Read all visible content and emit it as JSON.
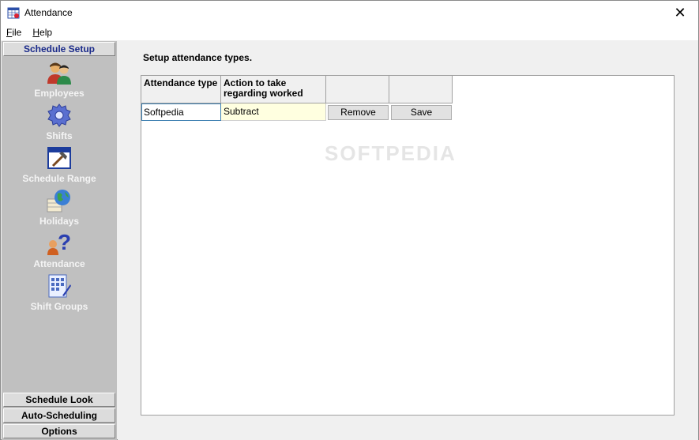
{
  "window": {
    "title": "Attendance",
    "close_glyph": "✕"
  },
  "menu": {
    "file_ul": "F",
    "file_rest": "ile",
    "help_ul": "H",
    "help_rest": "elp"
  },
  "sidebar": {
    "top_header": "Schedule Setup",
    "items": [
      {
        "label": "Employees",
        "icon": "employees-icon"
      },
      {
        "label": "Shifts",
        "icon": "shifts-gear-icon"
      },
      {
        "label": "Schedule Range",
        "icon": "schedule-range-icon"
      },
      {
        "label": "Holidays",
        "icon": "holidays-globe-icon"
      },
      {
        "label": "Attendance",
        "icon": "attendance-question-icon"
      },
      {
        "label": "Shift Groups",
        "icon": "shift-groups-icon"
      }
    ],
    "bottom_headers": [
      "Schedule Look",
      "Auto-Scheduling",
      "Options"
    ]
  },
  "main": {
    "heading": "Setup attendance types.",
    "columns": [
      "Attendance type",
      "Action to take regarding worked",
      "",
      ""
    ],
    "column_line1": "Action to take",
    "column_line2": "regarding worked",
    "rows": [
      {
        "attendance_type": "Softpedia",
        "action": "Subtract",
        "remove_label": "Remove",
        "save_label": "Save"
      }
    ]
  },
  "watermark": "SOFTPEDIA",
  "colors": {
    "sidebar_bg": "#c0c0c0",
    "active_header": "#1a2a8a",
    "action_cell_bg": "#ffffe0",
    "input_border": "#3c7fb1"
  }
}
